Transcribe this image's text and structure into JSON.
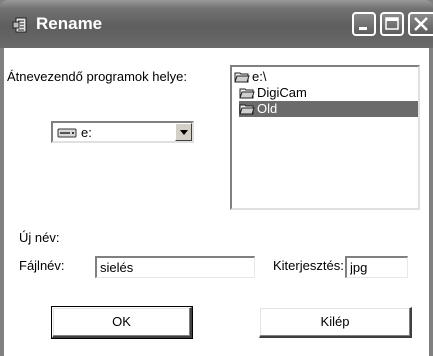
{
  "window": {
    "title": "Rename"
  },
  "form": {
    "location_label": "Átnevezendő programok helye:",
    "drive_value": "e:",
    "directories": [
      "e:\\",
      "DigiCam",
      "Old"
    ],
    "selected_directory": "Old",
    "new_name_label": "Új név:",
    "filename_label": "Fájlnév:",
    "filename_value": "sielés",
    "extension_label": "Kiterjesztés:",
    "extension_value": "jpg"
  },
  "buttons": {
    "ok_label": "OK",
    "exit_label": "Kilép"
  },
  "colors": {
    "titlebar": "#6a6a6a",
    "selection": "#6b6b6b"
  }
}
